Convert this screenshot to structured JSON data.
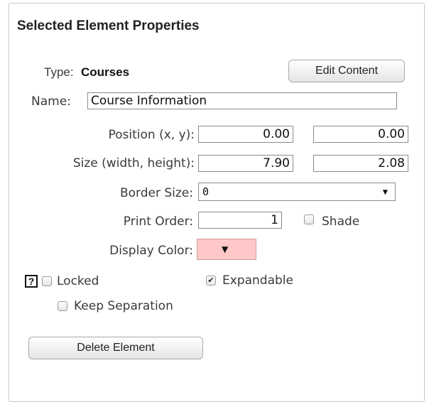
{
  "panel": {
    "title": "Selected Element Properties",
    "type_label": "Type:",
    "type_value": "Courses",
    "edit_content_label": "Edit Content",
    "name_label": "Name:",
    "name_value": "Course Information",
    "position_label": "Position (x, y):",
    "position_x": "0.00",
    "position_y": "0.00",
    "size_label": "Size (width, height):",
    "size_width": "7.90",
    "size_height": "2.08",
    "border_label": "Border Size:",
    "border_value": "0",
    "print_order_label": "Print Order:",
    "print_order_value": "1",
    "shade_label": "Shade",
    "shade_checked": false,
    "display_color_label": "Display Color:",
    "display_color": "#ffc8c8",
    "help_label": "?",
    "locked_label": "Locked",
    "locked_checked": false,
    "expandable_label": "Expandable",
    "expandable_checked": true,
    "keep_separation_label": "Keep Separation",
    "keep_separation_checked": false,
    "delete_label": "Delete Element"
  }
}
